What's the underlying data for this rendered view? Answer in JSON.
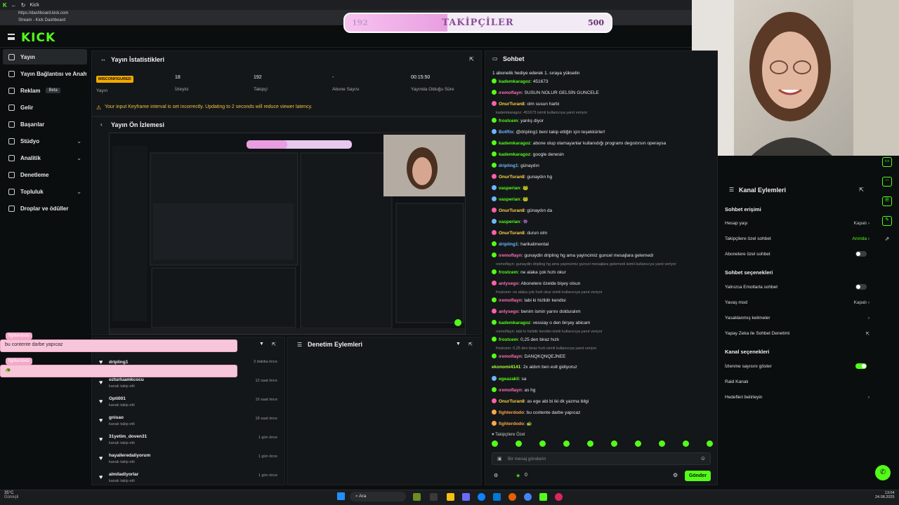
{
  "browser": {
    "tab_title": "Kick",
    "url": "https://dashboard.kick.com",
    "breadcrumb": "Stream - Kick Dashboard"
  },
  "goal": {
    "current": "192",
    "label": "TAKİPÇİLER",
    "max": "500",
    "progress": 0.384
  },
  "sidebar": {
    "items": [
      {
        "label": "Yayın",
        "active": true,
        "chevron": ""
      },
      {
        "label": "Yayın Bağlantısı ve Anahtarı",
        "active": false,
        "chevron": ""
      },
      {
        "label": "Reklam",
        "active": false,
        "chevron": "",
        "badge": "Beta"
      },
      {
        "label": "Gelir",
        "active": false,
        "chevron": ""
      },
      {
        "label": "Başarılar",
        "active": false,
        "chevron": ""
      },
      {
        "label": "Stüdyo",
        "active": false,
        "chevron": "⌄"
      },
      {
        "label": "Analitik",
        "active": false,
        "chevron": "⌄"
      },
      {
        "label": "Denetleme",
        "active": false,
        "chevron": ""
      },
      {
        "label": "Topluluk",
        "active": false,
        "chevron": "⌄"
      },
      {
        "label": "Droplar ve ödüller",
        "active": false,
        "chevron": ""
      }
    ]
  },
  "stats": {
    "title": "Yayın İstatistikleri",
    "items": [
      {
        "value": "MISCONFIGURED",
        "label": "Yayın"
      },
      {
        "value": "18",
        "label": "İzleyici"
      },
      {
        "value": "192",
        "label": "Takipçi"
      },
      {
        "value": "-",
        "label": "Abone Sayısı"
      },
      {
        "value": "00:15:50",
        "label": "Yayında Olduğu Süre"
      }
    ],
    "warning": "Your input Keyframe interval is set incorrectly. Updating to 2 seconds will reduce viewer latency."
  },
  "preview": {
    "title": "Yayın Ön İzlemesi"
  },
  "overlay": {
    "tag1": "fighterdodo",
    "msg1": "bu contente darbe yapıcaz",
    "tag2": "fighterdodo",
    "msg2": "🐢"
  },
  "follows": {
    "items": [
      {
        "name": "dripling1",
        "sub": "",
        "time": "3 dakika önce"
      },
      {
        "name": "ozturluamkcocu",
        "sub": "kanalı takip etti",
        "time": "12 saat önce"
      },
      {
        "name": "Opti001",
        "sub": "kanalı takip etti",
        "time": "15 saat önce"
      },
      {
        "name": "gnisao",
        "sub": "kanalı takip etti",
        "time": "18 saat önce"
      },
      {
        "name": "31yetim_doven31",
        "sub": "kanalı takip etti",
        "time": "1 gün önce"
      },
      {
        "name": "hayalleredaliyorum",
        "sub": "kanalı takip etti",
        "time": "1 gün önce"
      },
      {
        "name": "almiladiyorlar",
        "sub": "kanalı takip etti",
        "time": "1 gün önce"
      }
    ]
  },
  "mod_actions": {
    "title": "Denetim Eylemleri"
  },
  "chat": {
    "title": "Sohbet",
    "pinned": "1 abonelik hediye ederek 1. sıraya yükselin",
    "messages": [
      {
        "user": "kademkaragoz",
        "text": "451673",
        "color": "green",
        "badge": "#53fc18"
      },
      {
        "user": "ıremoflayn",
        "text": "SUSUN NOLUR GELSİN GUNCELE",
        "color": "pink",
        "badge": "#53fc18"
      },
      {
        "user": "OnurTuran8",
        "text": "olm susun harbi",
        "color": "yellow",
        "badge": "#ff5fa8"
      },
      {
        "sys": "kademkaragoz: 451673 isimli kullanıcıya yanıt veriyor"
      },
      {
        "user": "frostcem",
        "text": "yanlış diyor",
        "color": "green",
        "badge": "#53fc18"
      },
      {
        "user": "BotRix",
        "text": "@dripling1 beni takip ettiğin için teşekkürler!",
        "color": "blue",
        "badge": "#6fb6ff"
      },
      {
        "user": "kademkaragoz",
        "text": "abone olup olamayanlar kullanıdığı programı degıstırsın operaysa",
        "color": "green",
        "badge": "#53fc18"
      },
      {
        "user": "kademkaragoz",
        "text": "google denesin",
        "color": "green",
        "badge": "#53fc18"
      },
      {
        "user": "dripling1",
        "text": "günaydın",
        "color": "blue",
        "badge": "#53fc18"
      },
      {
        "user": "OnurTuran8",
        "text": "gunaydın hg",
        "color": "yellow",
        "badge": "#ff5fa8"
      },
      {
        "user": "vasperian",
        "text": "🐸",
        "color": "green",
        "badge": "#6fb6ff"
      },
      {
        "user": "vasperian",
        "text": "🐸",
        "color": "green",
        "badge": "#6fb6ff"
      },
      {
        "user": "OnurTuran8",
        "text": "günaydın da",
        "color": "yellow",
        "badge": "#ff5fa8"
      },
      {
        "user": "vasperian",
        "text": "👾",
        "color": "green",
        "badge": "#6fb6ff"
      },
      {
        "user": "OnurTuran8",
        "text": "durun olm",
        "color": "yellow",
        "badge": "#ff5fa8"
      },
      {
        "user": "dripling1",
        "text": "harikalimental",
        "color": "blue",
        "badge": "#53fc18"
      },
      {
        "user": "ıremoflayn",
        "text": "gunaydin dripling hg ama yayincimiz guncel mesajlara gelemedi",
        "color": "pink",
        "badge": "#53fc18"
      },
      {
        "sys": "ıremoflayn: gunaydin dripling hg ama yayincimiz guncel mesajlara gelemedi isimli kullanıcıya yanıt veriyor"
      },
      {
        "user": "frostcem",
        "text": "ne alaka çok hızlı okur",
        "color": "green",
        "badge": "#53fc18"
      },
      {
        "user": "anlysego",
        "text": "Abonelere özelde bişey olsun",
        "color": "pink",
        "badge": "#ff5fa8"
      },
      {
        "sys": "frostcem: ne alaka çok hızlı okur isimli kullanıcıya yanıt veriyor"
      },
      {
        "user": "ıremoflayn",
        "text": "tabi ki hizlidir kendisi",
        "color": "pink",
        "badge": "#53fc18"
      },
      {
        "user": "anlysego",
        "text": "benim ismin yarını dolduralım",
        "color": "pink",
        "badge": "#ff5fa8"
      },
      {
        "user": "kademkaragoz",
        "text": "vessiay o den birşey abicam",
        "color": "green",
        "badge": "#53fc18"
      },
      {
        "sys": "ıremoflayn: tabi ki hizlidir kendisi isimli kullanıcıya yanıt veriyor"
      },
      {
        "user": "frostcem",
        "text": "0,25 den biraz hızlı",
        "color": "green",
        "badge": "#53fc18"
      },
      {
        "sys": "frostcem: 0,25 den biraz hızlı isimli kullanıcıya yanıt veriyor"
      },
      {
        "user": "ıremoflayn",
        "text": "DANQKQNQEJNEE",
        "color": "pink",
        "badge": "#53fc18"
      },
      {
        "user": "ekonomi4141",
        "text": "2x aldım ben eslt gidiyoruz",
        "color": "lime",
        "badge": ""
      },
      {
        "user": "egeazakli",
        "text": "sa",
        "color": "green",
        "badge": "#6fb6ff"
      },
      {
        "user": "ıremoflayn",
        "text": "as hg",
        "color": "pink",
        "badge": "#53fc18"
      },
      {
        "user": "OnurTuran8",
        "text": "as ege abi bi iki dk yazma bilgi",
        "color": "yellow",
        "badge": "#ff5fa8"
      },
      {
        "user": "fighterdodo",
        "text": "bu contente darbe yapıcaz",
        "color": "orange",
        "badge": "#ffa64a"
      },
      {
        "user": "fighterdodo",
        "text": "🐢",
        "color": "orange",
        "badge": "#ffa64a"
      }
    ],
    "followers_only": "Takipçilere Özel",
    "input_placeholder": "Bir mesaj gönderin",
    "points": "0",
    "send_label": "Gönder"
  },
  "channel_actions": {
    "title": "Kanal Eylemleri",
    "sections": [
      {
        "title": "Sohbet erişimi"
      },
      {
        "title": "Sohbet seçenekleri"
      },
      {
        "title": "Kanal seçenekleri"
      }
    ],
    "rows": {
      "account_age": {
        "label": "Hesap yaşı",
        "value": "Kapalı"
      },
      "followers_chat": {
        "label": "Takipçilere özel sohbet",
        "value": "Anında"
      },
      "subs_chat": {
        "label": "Abonelere özel sohbet",
        "on": false
      },
      "emote_only": {
        "label": "Yalnızca Emotlarla sohbet",
        "on": false
      },
      "slow_mode": {
        "label": "Yavaş mod",
        "value": "Kapalı"
      },
      "banned_words": {
        "label": "Yasaklanmış kelimeler"
      },
      "ai_moderation": {
        "label": "Yapay Zeka ile Sohbet Denetimi"
      },
      "viewer_count": {
        "label": "İzlenme sayısını göster",
        "on": true
      },
      "raid": {
        "label": "Raid Kanalı"
      },
      "goals": {
        "label": "Hedefleri belirleyin"
      }
    }
  },
  "taskbar": {
    "weather_temp": "35°C",
    "weather_desc": "Güneşli",
    "search_label": "Ara",
    "time": "13:04",
    "date": "24.08.2025"
  },
  "colors": {
    "accent": "#53fc18",
    "background": "#0b0e0f",
    "panel": "#141719"
  }
}
